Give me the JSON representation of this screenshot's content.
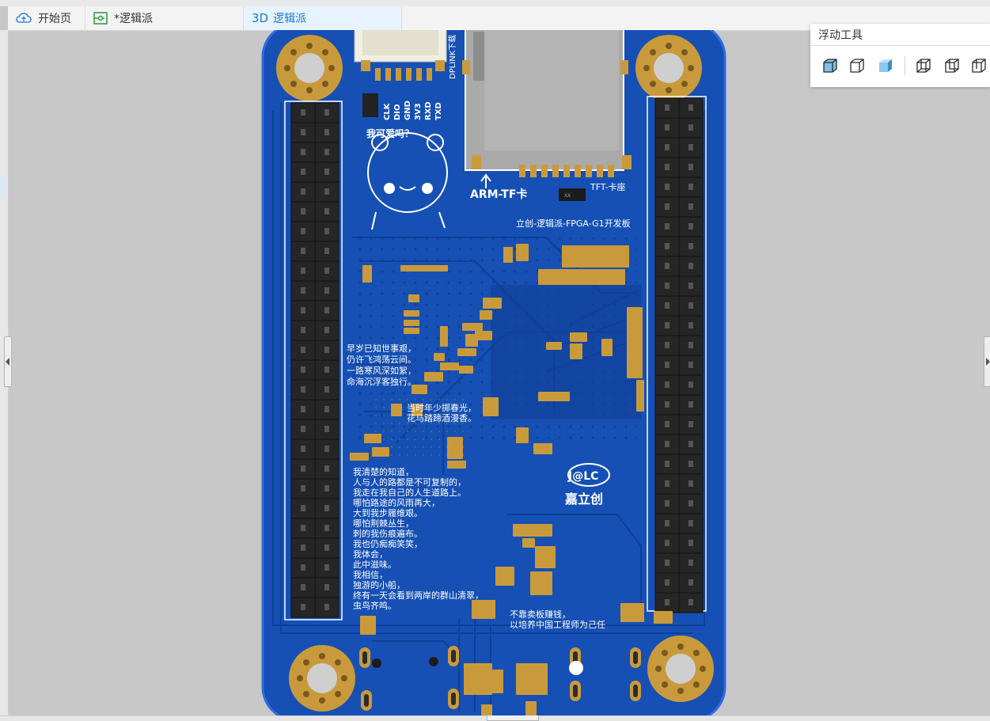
{
  "tabs": [
    {
      "label": "开始页",
      "icon": "cloud-icon"
    },
    {
      "label": "*逻辑派",
      "icon": "schematic-icon"
    },
    {
      "label": "逻辑派",
      "badge": "3D",
      "icon": "3d-icon"
    }
  ],
  "floating_toolbar": {
    "title": "浮动工具",
    "tools": [
      "cube-shaded-icon",
      "cube-wireframe-icon",
      "cube-transparent-icon",
      "view-front-icon",
      "view-right-icon",
      "view-back-icon"
    ]
  },
  "pcb": {
    "texts": {
      "dplink": "DPLINK下载",
      "pins": [
        "CLK",
        "DIO",
        "GND",
        "3V3",
        "RXD",
        "TXD"
      ],
      "mascot_text": "我可爱吗？",
      "arm_tf": "ARM-TF卡",
      "tft_slot": "TFT-卡座",
      "board_title": "立创-逻辑派-FPGA-G1开发板",
      "poem1": [
        "早岁已知世事艰，",
        "仍许飞鸿荡云间。",
        "一路寒风深如絮，",
        "命海沉浮客独行。"
      ],
      "poem2": [
        "当时年少掷春光，",
        "花马踏蹄酒漫香。"
      ],
      "poem3": [
        "我清楚的知道，",
        "人与人的路都是不可复制的，",
        "我走在我自己的人生道路上。",
        "哪怕路途的风雨再大，",
        "大到我步履维艰。",
        "哪怕荆棘丛生，",
        "刺的我伤痕遍布。",
        "我也仍痴痴笑笑，",
        "我体会，",
        "此中滋味。",
        "我相信，",
        "独游的小船，",
        "终有一天会看到两岸的群山清翠，",
        "虫鸟齐鸣。"
      ],
      "motto": [
        "不靠卖板赚钱，",
        "以培养中国工程师为己任"
      ],
      "logo": "J@LC",
      "brand": "嘉立创",
      "chip_mark": "XX"
    },
    "colors": {
      "board": "#1650b4",
      "edge": "#2f6be0",
      "gold": "#c99a3c",
      "header": "#262626",
      "silk": "#ffffff"
    }
  }
}
